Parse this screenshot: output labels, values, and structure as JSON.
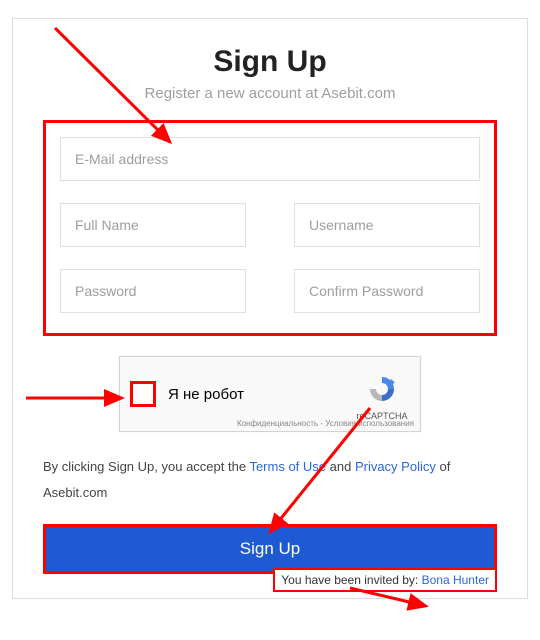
{
  "header": {
    "title": "Sign Up",
    "subtitle": "Register a new account at Asebit.com"
  },
  "fields": {
    "email_placeholder": "E-Mail address",
    "fullname_placeholder": "Full Name",
    "username_placeholder": "Username",
    "password_placeholder": "Password",
    "confirm_placeholder": "Confirm Password"
  },
  "captcha": {
    "label": "Я не робот",
    "brand": "reCAPTCHA",
    "privacy": "Конфиденциальность",
    "dash": " - ",
    "terms": "Условия использования"
  },
  "consent": {
    "prefix": "By clicking Sign Up, you accept the ",
    "terms": "Terms of Use",
    "and": " and ",
    "privacy": "Privacy Policy",
    "suffix": " of Asebit.com"
  },
  "button": {
    "label": "Sign Up"
  },
  "invited": {
    "prefix": "You have been invited by: ",
    "name": "Bona Hunter"
  }
}
